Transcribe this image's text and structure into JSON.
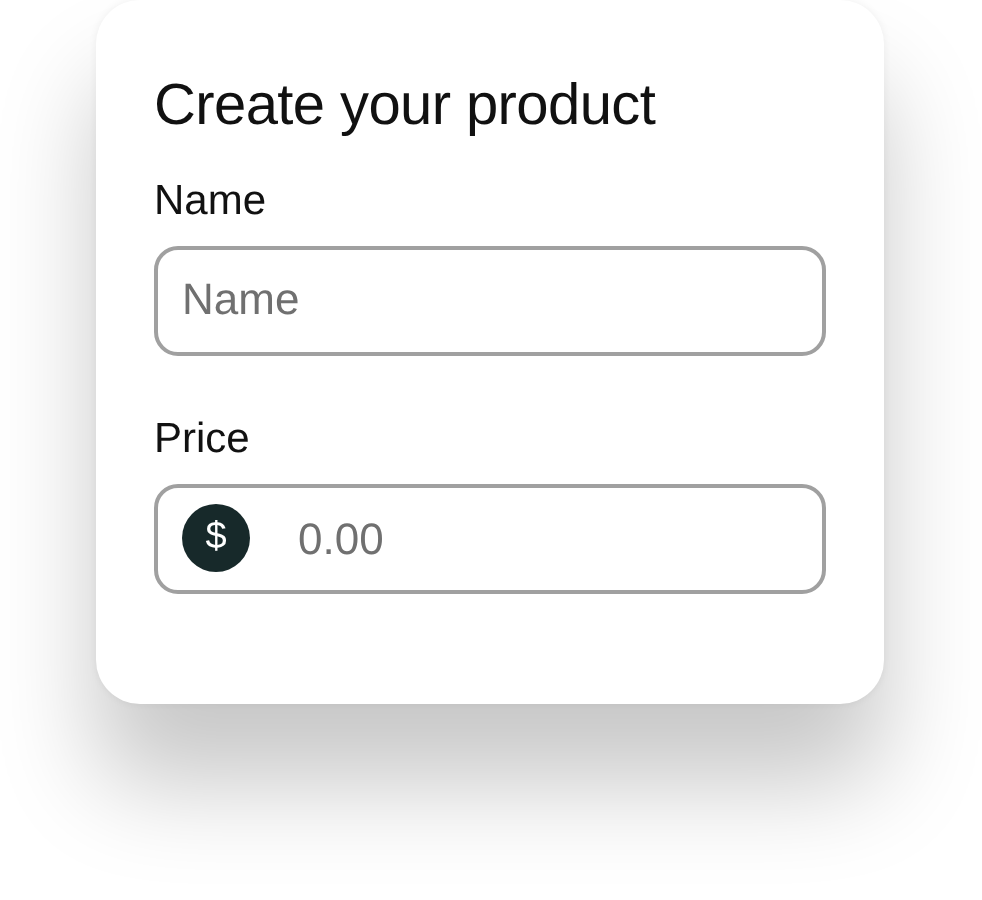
{
  "card": {
    "title": "Create your product",
    "fields": [
      {
        "kind": "text",
        "label": "Name",
        "placeholder": "Name"
      },
      {
        "kind": "currency",
        "label": "Price",
        "symbol": "$",
        "placeholder": "0.00"
      }
    ]
  }
}
